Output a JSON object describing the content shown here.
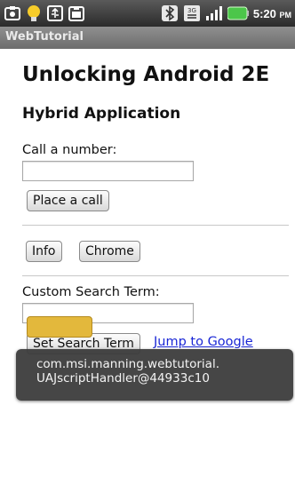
{
  "status_bar": {
    "icons": [
      "screenshot-icon",
      "lightbulb-icon",
      "usb-icon",
      "sdcard-icon",
      "bluetooth-icon",
      "3g-icon",
      "signal-icon",
      "battery-icon"
    ],
    "time": "5:20",
    "ampm": "PM"
  },
  "titlebar": {
    "title": "WebTutorial"
  },
  "page": {
    "heading": "Unlocking Android 2E",
    "subheading": "Hybrid Application",
    "call_label": "Call a number:",
    "call_input_value": "",
    "place_call_button": "Place a call",
    "info_button": "Info",
    "chrome_button": "Chrome",
    "search_label": "Custom Search Term:",
    "search_input_value": "",
    "set_search_button": "Set Search Term",
    "jump_link": "Jump to Google"
  },
  "toast": {
    "line1": "com.msi.manning.webtutorial.",
    "line2": "UAJscriptHandler@44933c10"
  },
  "colors": {
    "link": "#1a27d6",
    "toast_bg": "#3a3a3a",
    "statusbar_bg": "#2b2b2b",
    "titlebar_bg": "#7a7a7a"
  }
}
